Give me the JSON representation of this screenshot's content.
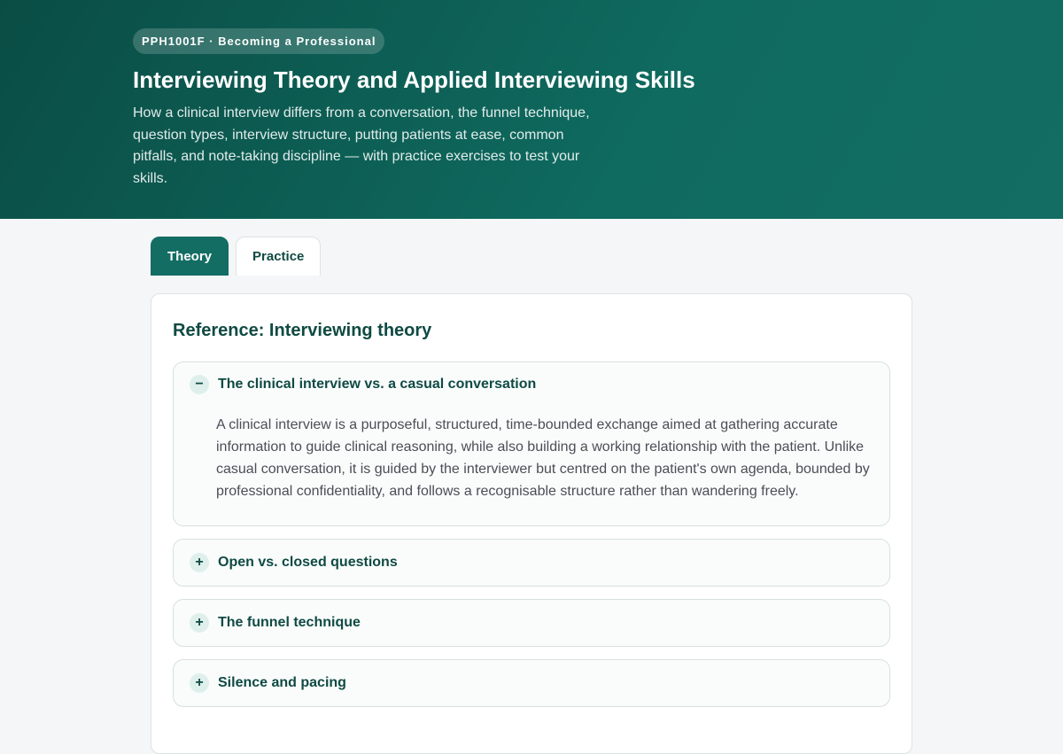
{
  "hero": {
    "course_label": "PPH1001F · Becoming a Professional",
    "title": "Interviewing Theory and Applied Interviewing Skills",
    "description": "How a clinical interview differs from a conversation, the funnel technique, question types, interview structure, putting patients at ease, common pitfalls, and note-taking discipline — with practice exercises to test your skills."
  },
  "tabs": [
    {
      "label": "Theory",
      "active": true
    },
    {
      "label": "Practice",
      "active": false
    }
  ],
  "reference": {
    "title": "Reference: Interviewing theory",
    "sections": [
      {
        "icon": "minus-icon",
        "icon_glyph": "−",
        "title": "The clinical interview vs. a casual conversation",
        "expanded": true,
        "body": "A clinical interview is a purposeful, structured, time-bounded exchange aimed at gathering accurate information to guide clinical reasoning, while also building a working relationship with the patient. Unlike casual conversation, it is guided by the interviewer but centred on the patient's own agenda, bounded by professional confidentiality, and follows a recognisable structure rather than wandering freely."
      },
      {
        "icon": "plus-icon",
        "icon_glyph": "+",
        "title": "Open vs. closed questions",
        "expanded": false
      },
      {
        "icon": "plus-icon",
        "icon_glyph": "+",
        "title": "The funnel technique",
        "expanded": false
      },
      {
        "icon": "plus-icon",
        "icon_glyph": "+",
        "title": "Silence and pacing",
        "expanded": false
      }
    ]
  },
  "colors": {
    "brand": "#0f6a5f",
    "heading": "#0f4a43",
    "background": "#f4f6f7"
  }
}
